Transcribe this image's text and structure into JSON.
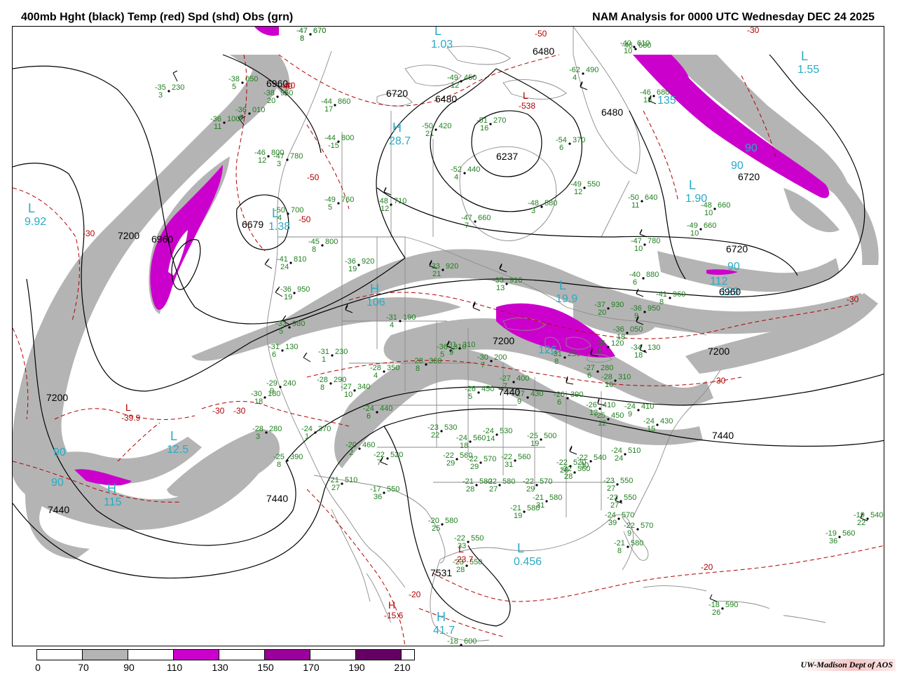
{
  "title_left": "400mb Hght (black) Temp (red) Spd (shd) Obs (grn)",
  "title_right": "NAM Analysis for 0000 UTC Wednesday  DEC 24 2025",
  "credit": "UW-Madison  Dept of AOS",
  "colors": {
    "height": "#000000",
    "temperature": "#b40000",
    "obs": "#1f7f1f",
    "centers": "#2aaac4",
    "speed_70_90": "#b4b4b4",
    "speed_110_130": "#cc00cc",
    "map_lines": "#888888"
  },
  "legend": {
    "ticks": [
      "0",
      "70",
      "90",
      "110",
      "130",
      "150",
      "170",
      "190",
      "210"
    ],
    "segments": [
      {
        "color": "#ffffff"
      },
      {
        "color": "#b4b4b4"
      },
      {
        "color": "#ffffff"
      },
      {
        "color": "#cc00cc"
      },
      {
        "color": "#ffffff"
      },
      {
        "color": "#9a009a"
      },
      {
        "color": "#ffffff"
      },
      {
        "color": "#640064"
      },
      {
        "color": "#ffffff"
      }
    ]
  },
  "height_labels": [
    "6960",
    "6720",
    "6480",
    "6480",
    "6480",
    "6720",
    "6720",
    "6960",
    "7200",
    "6960",
    "6679",
    "7200",
    "7200",
    "7200",
    "7440",
    "7440",
    "7440",
    "7440",
    "7531",
    "6237"
  ],
  "temp_labels": [
    "-40",
    "-50",
    "-50",
    "-50",
    "-30",
    "-30",
    "-30",
    "-30",
    "-30",
    "-30",
    "-20",
    "-20",
    "-40"
  ],
  "centers": [
    {
      "type": "L",
      "value": "1.03"
    },
    {
      "type": "L",
      "value": "1.55"
    },
    {
      "type": "L",
      "value": "9.92"
    },
    {
      "type": "H",
      "value": "28.7"
    },
    {
      "type": "L",
      "value": "1.38"
    },
    {
      "type": "L",
      "value": "1.90"
    },
    {
      "type": "L",
      "value": "19.9"
    },
    {
      "type": "H",
      "value": "106"
    },
    {
      "type": "L",
      "value": "12.5"
    },
    {
      "type": "H",
      "value": "115"
    },
    {
      "type": "L",
      "value": "0.456"
    },
    {
      "type": "H",
      "value": "41.7"
    },
    {
      "type": "L",
      "value": "-538"
    },
    {
      "type": "L",
      "value": "-39.9"
    },
    {
      "type": "H",
      "value": "-15.6"
    },
    {
      "type": "L",
      "value": "-23.7"
    }
  ],
  "speed_labels": [
    "90",
    "90",
    "90",
    "90",
    "90",
    "135",
    "126",
    "112",
    "129"
  ],
  "observations": [
    {
      "temp": "-38",
      "value": "050",
      "dew": "5"
    },
    {
      "temp": "-35",
      "value": "230",
      "dew": "3"
    },
    {
      "temp": "-36",
      "value": "010",
      "dew": "6"
    },
    {
      "temp": "-36",
      "value": "100",
      "dew": "11"
    },
    {
      "temp": "-38",
      "value": "950",
      "dew": "20"
    },
    {
      "temp": "-44",
      "value": "860",
      "dew": "17"
    },
    {
      "temp": "-44",
      "value": "800",
      "dew": "-15"
    },
    {
      "temp": "-46",
      "value": "800",
      "dew": "12"
    },
    {
      "temp": "-47",
      "value": "780",
      "dew": "3"
    },
    {
      "temp": "-49",
      "value": "760",
      "dew": "5"
    },
    {
      "temp": "-50",
      "value": "700",
      "dew": "4"
    },
    {
      "temp": "-45",
      "value": "800",
      "dew": "8"
    },
    {
      "temp": "-41",
      "value": "810",
      "dew": "24"
    },
    {
      "temp": "-36",
      "value": "950",
      "dew": "19"
    },
    {
      "temp": "-33",
      "value": "980",
      "dew": "5"
    },
    {
      "temp": "-31",
      "value": "130",
      "dew": "6"
    },
    {
      "temp": "-31",
      "value": "230",
      "dew": "1"
    },
    {
      "temp": "-29",
      "value": "240",
      "dew": "9"
    },
    {
      "temp": "-30",
      "value": "180",
      "dew": "18"
    },
    {
      "temp": "-28",
      "value": "290",
      "dew": "8"
    },
    {
      "temp": "-27",
      "value": "340",
      "dew": "10"
    },
    {
      "temp": "-28",
      "value": "350",
      "dew": "4"
    },
    {
      "temp": "-28",
      "value": "280",
      "dew": "3"
    },
    {
      "temp": "-24",
      "value": "370",
      "dew": "1"
    },
    {
      "temp": "-24",
      "value": "440",
      "dew": "6"
    },
    {
      "temp": "-20",
      "value": "460",
      "dew": "2"
    },
    {
      "temp": "-25",
      "value": "390",
      "dew": "8"
    },
    {
      "temp": "-22",
      "value": "520",
      "dew": "7"
    },
    {
      "temp": "-21",
      "value": "510",
      "dew": "27"
    },
    {
      "temp": "-17",
      "value": "550",
      "dew": "36"
    },
    {
      "temp": "-49",
      "value": "450",
      "dew": "12"
    },
    {
      "temp": "-50",
      "value": "420",
      "dew": "21"
    },
    {
      "temp": "-52",
      "value": "440",
      "dew": "4"
    },
    {
      "temp": "-51",
      "value": "270",
      "dew": "16"
    },
    {
      "temp": "-54",
      "value": "370",
      "dew": "6"
    },
    {
      "temp": "-62",
      "value": "490",
      "dew": "4"
    },
    {
      "temp": "-48",
      "value": "710",
      "dew": "12"
    },
    {
      "temp": "-47",
      "value": "660",
      "dew": "7"
    },
    {
      "temp": "-48",
      "value": "580",
      "dew": "3"
    },
    {
      "temp": "-49",
      "value": "550",
      "dew": "12"
    },
    {
      "temp": "-50",
      "value": "640",
      "dew": "11"
    },
    {
      "temp": "-48",
      "value": "660",
      "dew": "10"
    },
    {
      "temp": "-49",
      "value": "660",
      "dew": "10"
    },
    {
      "temp": "-46",
      "value": "680",
      "dew": "18"
    },
    {
      "temp": "-47",
      "value": "670",
      "dew": "8"
    },
    {
      "temp": "-47",
      "value": "780",
      "dew": "10"
    },
    {
      "temp": "-40",
      "value": "880",
      "dew": "6"
    },
    {
      "temp": "-41",
      "value": "960",
      "dew": "8"
    },
    {
      "temp": "-37",
      "value": "930",
      "dew": "20"
    },
    {
      "temp": "-36",
      "value": "950",
      "dew": "9"
    },
    {
      "temp": "-36",
      "value": "050",
      "dew": "18"
    },
    {
      "temp": "-34",
      "value": "130",
      "dew": "18"
    },
    {
      "temp": "-35",
      "value": "120",
      "dew": "5"
    },
    {
      "temp": "-36",
      "value": "310",
      "dew": "5"
    },
    {
      "temp": "-36",
      "value": "920",
      "dew": "19"
    },
    {
      "temp": "-33",
      "value": "920",
      "dew": "21"
    },
    {
      "temp": "-35",
      "value": "910",
      "dew": "13"
    },
    {
      "temp": "-31",
      "value": "190",
      "dew": "4"
    },
    {
      "temp": "-31",
      "value": "310",
      "dew": "9"
    },
    {
      "temp": "-28",
      "value": "360",
      "dew": "8"
    },
    {
      "temp": "-30",
      "value": "200",
      "dew": "7"
    },
    {
      "temp": "-31",
      "value": "250",
      "dew": "8"
    },
    {
      "temp": "-27",
      "value": "280",
      "dew": "6"
    },
    {
      "temp": "-28",
      "value": "310",
      "dew": "16"
    },
    {
      "temp": "-27",
      "value": "400",
      "dew": "7"
    },
    {
      "temp": "-27",
      "value": "430",
      "dew": "9"
    },
    {
      "temp": "-26",
      "value": "450",
      "dew": "5"
    },
    {
      "temp": "-26",
      "value": "390",
      "dew": "6"
    },
    {
      "temp": "-26",
      "value": "410",
      "dew": "12"
    },
    {
      "temp": "-25",
      "value": "450",
      "dew": "12"
    },
    {
      "temp": "-24",
      "value": "430",
      "dew": "15"
    },
    {
      "temp": "-24",
      "value": "410",
      "dew": "9"
    },
    {
      "temp": "-23",
      "value": "530",
      "dew": "22"
    },
    {
      "temp": "-24",
      "value": "560",
      "dew": "18"
    },
    {
      "temp": "-24",
      "value": "530",
      "dew": "14"
    },
    {
      "temp": "-25",
      "value": "500",
      "dew": "19"
    },
    {
      "temp": "-22",
      "value": "560",
      "dew": "29"
    },
    {
      "temp": "-22",
      "value": "570",
      "dew": "29"
    },
    {
      "temp": "-22",
      "value": "560",
      "dew": "31"
    },
    {
      "temp": "-22",
      "value": "560",
      "dew": "28"
    },
    {
      "temp": "-22",
      "value": "520",
      "dew": "28"
    },
    {
      "temp": "-22",
      "value": "540",
      "dew": "30"
    },
    {
      "temp": "-24",
      "value": "510",
      "dew": "24"
    },
    {
      "temp": "-21",
      "value": "580",
      "dew": "28"
    },
    {
      "temp": "-22",
      "value": "580",
      "dew": "27"
    },
    {
      "temp": "-22",
      "value": "570",
      "dew": "29"
    },
    {
      "temp": "-21",
      "value": "580",
      "dew": "19"
    },
    {
      "temp": "-21",
      "value": "580",
      "dew": "31"
    },
    {
      "temp": "-23",
      "value": "550",
      "dew": "27"
    },
    {
      "temp": "-23",
      "value": "550",
      "dew": "27"
    },
    {
      "temp": "-24",
      "value": "570",
      "dew": "39"
    },
    {
      "temp": "-22",
      "value": "570",
      "dew": "9"
    },
    {
      "temp": "-21",
      "value": "580",
      "dew": "8"
    },
    {
      "temp": "-20",
      "value": "580",
      "dew": "25"
    },
    {
      "temp": "-22",
      "value": "550",
      "dew": "33"
    },
    {
      "temp": "-23",
      "value": "550",
      "dew": "28"
    },
    {
      "temp": "-19",
      "value": "560",
      "dew": "36"
    },
    {
      "temp": "-19",
      "value": "540",
      "dew": "22"
    },
    {
      "temp": "-18",
      "value": "590",
      "dew": "26"
    },
    {
      "temp": "-18",
      "value": "600",
      "dew": ""
    },
    {
      "temp": "-47",
      "value": "670",
      "dew": "8"
    },
    {
      "temp": "-46",
      "value": "680",
      "dew": ""
    },
    {
      "temp": "-40",
      "value": "610",
      "dew": "10"
    }
  ]
}
